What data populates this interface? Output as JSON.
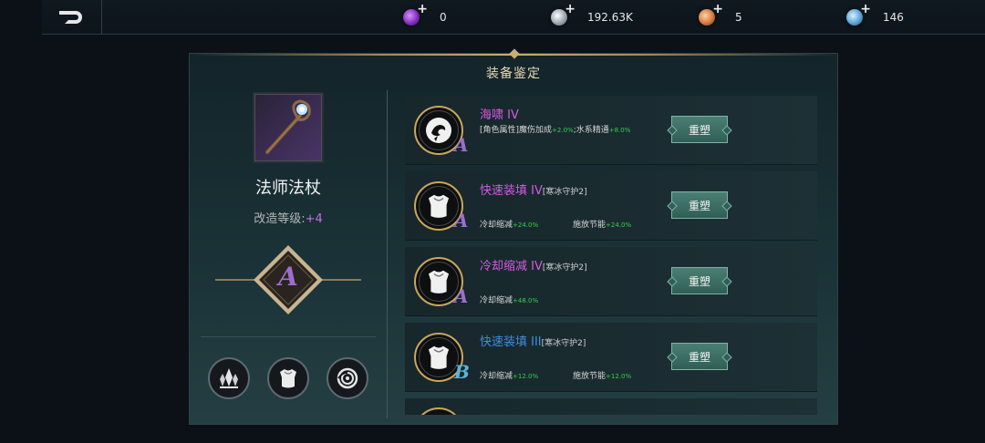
{
  "topbar": {
    "currencies": [
      {
        "icon": "purple-orb-icon",
        "color": "#9a3fd0",
        "value": "0"
      },
      {
        "icon": "silver-coin-icon",
        "color": "#a9b4bd",
        "value": "192.63K"
      },
      {
        "icon": "copper-orb-icon",
        "color": "#d4793e",
        "value": "5"
      },
      {
        "icon": "blue-crystal-icon",
        "color": "#5aa3d8",
        "value": "146"
      }
    ]
  },
  "panel": {
    "title": "装备鉴定",
    "item": {
      "name": "法师法杖",
      "level_label": "改造等级:",
      "level_value": "+4",
      "grade": "A"
    },
    "bottom_icons": [
      "crystal-icon",
      "armor-icon",
      "swirl-icon"
    ]
  },
  "attributes": [
    {
      "name": "海啸 IV",
      "name_color": "#d45be0",
      "tag": "",
      "grade": "A",
      "grade_color": "#9c6ed0",
      "icon": "wave-emblem-icon",
      "desc": "[角色属性]魔伤加成",
      "desc_v1": "+2.0%",
      "desc_mid": ";水系精通",
      "desc_v2": "+8.0%",
      "stat1": "",
      "stat1_val": "",
      "stat2": "",
      "stat2_val": "",
      "button": "重塑"
    },
    {
      "name": "快速装填 IV",
      "name_color": "#d45be0",
      "tag": "[寒冰守护2]",
      "grade": "A",
      "grade_color": "#9c6ed0",
      "icon": "armor-emblem-icon",
      "desc": "",
      "desc_v1": "",
      "desc_mid": "",
      "desc_v2": "",
      "stat1": "冷却缩减",
      "stat1_val": "+24.0%",
      "stat2": "施放节能",
      "stat2_val": "+24.0%",
      "button": "重塑"
    },
    {
      "name": "冷却缩减 IV",
      "name_color": "#d45be0",
      "tag": "[寒冰守护2]",
      "grade": "A",
      "grade_color": "#9c6ed0",
      "icon": "armor-emblem-icon",
      "desc": "",
      "desc_v1": "",
      "desc_mid": "",
      "desc_v2": "",
      "stat1": "冷却缩减",
      "stat1_val": "+48.0%",
      "stat2": "",
      "stat2_val": "",
      "button": "重塑"
    },
    {
      "name": "快速装填 III",
      "name_color": "#3f8de0",
      "tag": "[寒冰守护2]",
      "grade": "B",
      "grade_color": "#5bb3d8",
      "icon": "armor-emblem-icon",
      "desc": "",
      "desc_v1": "",
      "desc_mid": "",
      "desc_v2": "",
      "stat1": "冷却缩减",
      "stat1_val": "+12.0%",
      "stat2": "施放节能",
      "stat2_val": "+12.0%",
      "button": "重塑"
    }
  ]
}
